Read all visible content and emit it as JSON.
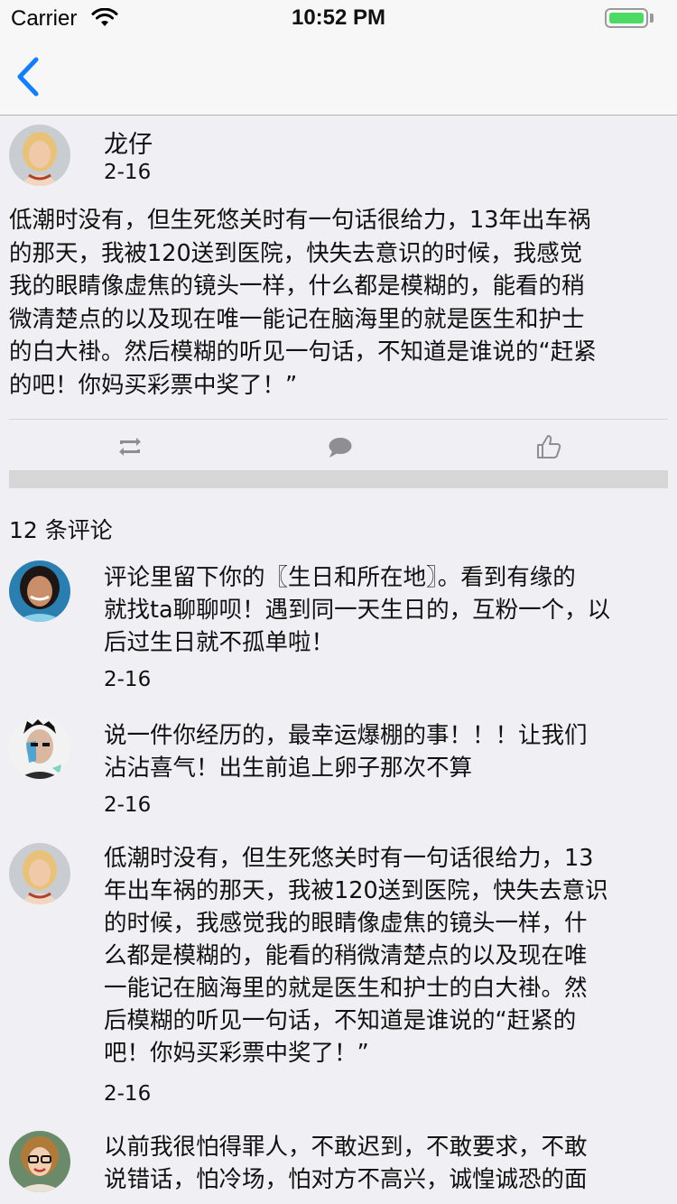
{
  "status_bar": {
    "carrier": "Carrier",
    "time": "10:52 PM",
    "battery_level": 1.0
  },
  "nav": {
    "back_icon": "chevron-left-icon",
    "accent": "#147efb"
  },
  "post": {
    "author": "龙仔",
    "date": "2-16",
    "content_lines": [
      "低潮时没有，但生死悠关时有一句话很给力，13年出车祸",
      "的那天，我被120送到医院，快失去意识的时候，我感觉",
      "我的眼睛像虚焦的镜头一样，什么都是模糊的，能看的稍",
      "微清楚点的以及现在唯一能记在脑海里的就是医生和护士",
      "的白大褂。然后模糊的听见一句话，不知道是谁说的“赶紧",
      "的吧！你妈买彩票中奖了！”"
    ],
    "actions": [
      "retweet-icon",
      "comment-icon",
      "like-icon"
    ]
  },
  "comments_header": "12 条评论",
  "comments": [
    {
      "lines": [
        "评论里留下你的〖生日和所在地〗。看到有缘的",
        "就找ta聊聊呗！遇到同一天生日的，互粉一个，以",
        "后过生日就不孤单啦！"
      ],
      "date": "2-16"
    },
    {
      "lines": [
        "说一件你经历的，最幸运爆棚的事！！！让我们",
        "沾沾喜气！出生前追上卵子那次不算"
      ],
      "date": "2-16"
    },
    {
      "lines": [
        "低潮时没有，但生死悠关时有一句话很给力，13",
        "年出车祸的那天，我被120送到医院，快失去意识",
        "的时候，我感觉我的眼睛像虚焦的镜头一样，什",
        "么都是模糊的，能看的稍微清楚点的以及现在唯",
        "一能记在脑海里的就是医生和护士的白大褂。然",
        "后模糊的听见一句话，不知道是谁说的“赶紧的",
        "吧！你妈买彩票中奖了！”"
      ],
      "date": "2-16"
    },
    {
      "lines": [
        "以前我很怕得罪人，不敢迟到，不敢要求，不敢",
        "说错话，怕冷场，怕对方不高兴，诚惶诚恐的面"
      ],
      "date": ""
    }
  ]
}
